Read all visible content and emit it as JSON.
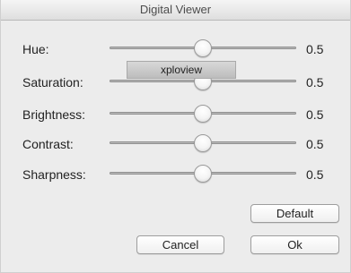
{
  "window": {
    "title": "Digital Viewer"
  },
  "sliders": [
    {
      "label": "Hue:",
      "value_text": "0.5",
      "level": 0.5
    },
    {
      "label": "Saturation:",
      "value_text": "0.5",
      "level": 0.5
    },
    {
      "label": "Brightness:",
      "value_text": "0.5",
      "level": 0.5
    },
    {
      "label": "Contrast:",
      "value_text": "0.5",
      "level": 0.5
    },
    {
      "label": "Sharpness:",
      "value_text": "0.5",
      "level": 0.5
    }
  ],
  "tooltip": {
    "text": "xploview"
  },
  "buttons": {
    "default_label": "Default",
    "cancel_label": "Cancel",
    "ok_label": "Ok"
  }
}
